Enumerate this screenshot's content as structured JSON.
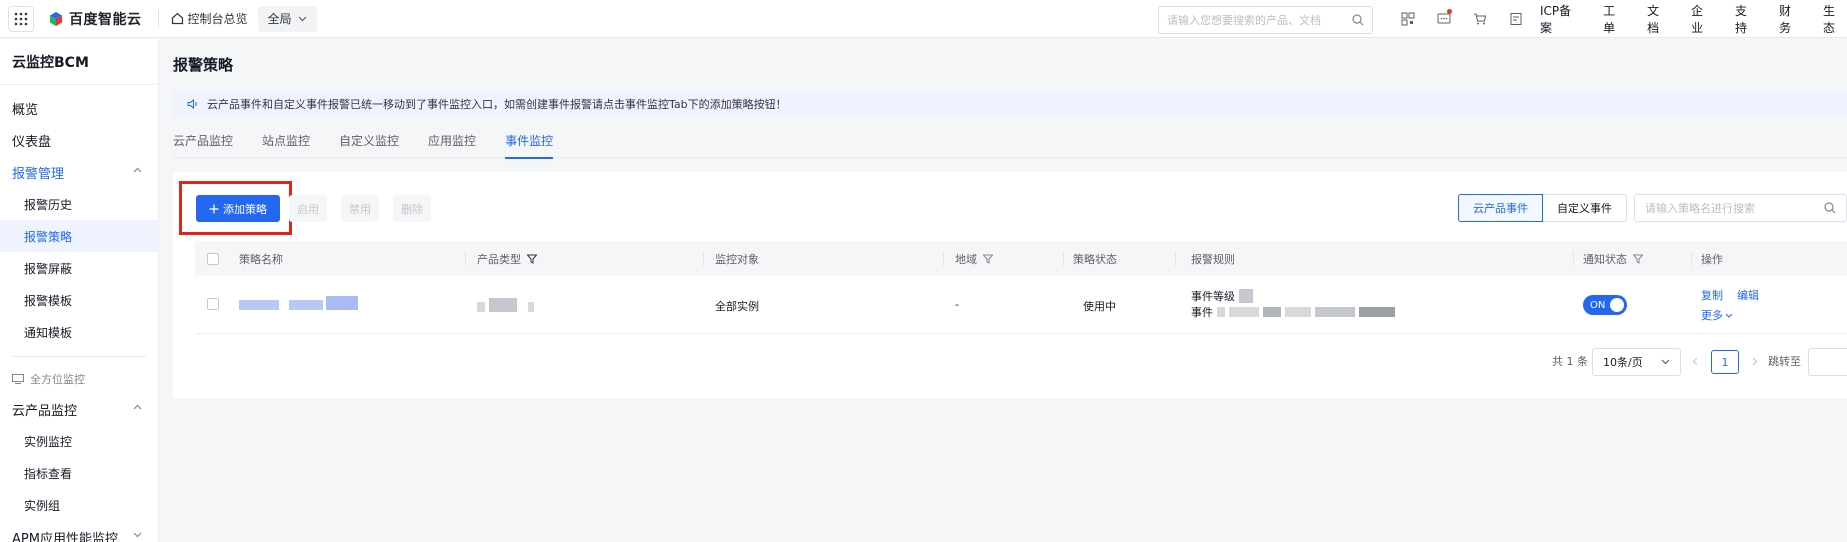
{
  "topbar": {
    "brand": "百度智能云",
    "console_link": "控制台总览",
    "region": "全局",
    "search_placeholder": "请输入您想要搜索的产品、文档",
    "links": [
      "ICP备案",
      "工单",
      "文档",
      "企业",
      "支持",
      "财务",
      "生态"
    ]
  },
  "sidebar": {
    "title": "云监控BCM",
    "items": [
      {
        "label": "概览"
      },
      {
        "label": "仪表盘"
      },
      {
        "label": "报警管理"
      },
      {
        "label": "报警历史"
      },
      {
        "label": "报警策略"
      },
      {
        "label": "报警屏蔽"
      },
      {
        "label": "报警模板"
      },
      {
        "label": "通知模板"
      }
    ],
    "group_label": "全方位监控",
    "group_items": [
      {
        "label": "云产品监控"
      },
      {
        "label": "实例监控"
      },
      {
        "label": "指标查看"
      },
      {
        "label": "实例组"
      },
      {
        "label": "APM应用性能监控"
      }
    ]
  },
  "page": {
    "title": "报警策略",
    "notice": "云产品事件和自定义事件报警已统一移动到了事件监控入口，如需创建事件报警请点击事件监控Tab下的添加策略按钮！",
    "tabs": [
      "云产品监控",
      "站点监控",
      "自定义监控",
      "应用监控",
      "事件监控"
    ],
    "active_tab": "事件监控"
  },
  "toolbar": {
    "add_label": "添加策略",
    "enable_label": "启用",
    "disable_label": "禁用",
    "delete_label": "删除",
    "seg_cloud": "云产品事件",
    "seg_custom": "自定义事件",
    "search_placeholder": "请输入策略名进行搜索"
  },
  "table": {
    "headers": {
      "name": "策略名称",
      "product": "产品类型",
      "target": "监控对象",
      "region": "地域",
      "status": "策略状态",
      "rule": "报警规则",
      "notify": "通知状态",
      "ops": "操作"
    },
    "rows": [
      {
        "target": "全部实例",
        "region": "-",
        "status": "使用中",
        "rule_line1": "事件等级",
        "rule_line2": "事件",
        "notify": "ON",
        "op_copy": "复制",
        "op_edit": "编辑",
        "op_more": "更多"
      }
    ]
  },
  "pager": {
    "total": "共 1 条",
    "page_size": "10条/页",
    "current": "1",
    "jump_label": "跳转至"
  },
  "colors": {
    "accent": "#2468f2",
    "highlight_box": "#e1251b"
  }
}
